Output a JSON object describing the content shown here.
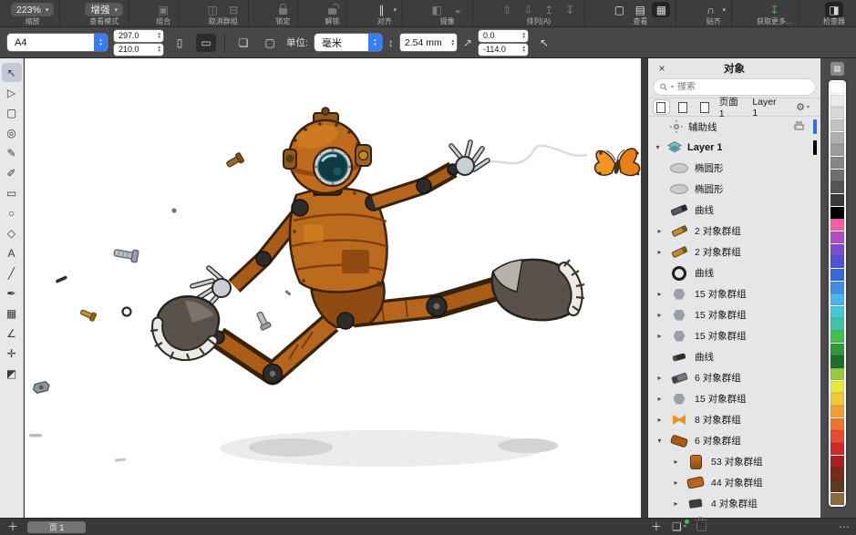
{
  "toolbar": {
    "groups": [
      {
        "type": "dropdown",
        "name": "zoom-level",
        "value": "223%",
        "label": "缩放"
      },
      {
        "type": "dropdown",
        "name": "view-mode",
        "value": "增强",
        "label": "查看模式"
      },
      {
        "type": "icons",
        "name": "combine",
        "label": "组合",
        "disabled": true,
        "icons": [
          {
            "name": "combine",
            "glyph": "▣"
          }
        ]
      },
      {
        "type": "icons",
        "name": "ungroup",
        "label": "取消群组",
        "disabled": true,
        "icons": [
          {
            "name": "ungroup",
            "glyph": "◫"
          },
          {
            "name": "ungroup-all",
            "glyph": "⊟"
          }
        ]
      },
      {
        "type": "icons",
        "name": "lock",
        "label": "锁定",
        "disabled": true,
        "icons": [
          {
            "name": "lock",
            "kind": "lock"
          }
        ]
      },
      {
        "type": "icons",
        "name": "unlock",
        "label": "解锁",
        "disabled": true,
        "icons": [
          {
            "name": "unlock",
            "kind": "lock-open"
          }
        ]
      },
      {
        "type": "icons",
        "name": "align",
        "label": "对齐",
        "dropdown": true,
        "icons": [
          {
            "name": "align",
            "glyph": "∥"
          }
        ]
      },
      {
        "type": "icons",
        "name": "mirror",
        "label": "镜像",
        "disabled": true,
        "icons": [
          {
            "name": "mirror-horizontal",
            "glyph": "◧"
          },
          {
            "name": "mirror-vertical",
            "glyph": "◒"
          }
        ]
      },
      {
        "type": "icons",
        "name": "order",
        "label": "排列(A)",
        "disabled": true,
        "icons": [
          {
            "name": "to-front",
            "glyph": "⇧"
          },
          {
            "name": "to-back",
            "glyph": "⇩"
          },
          {
            "name": "forward-one",
            "glyph": "↥"
          },
          {
            "name": "back-one",
            "glyph": "↧"
          }
        ]
      },
      {
        "type": "icons",
        "name": "view",
        "label": "查看",
        "icons": [
          {
            "name": "page-view",
            "glyph": "▢"
          },
          {
            "name": "wireframe-view",
            "glyph": "▤"
          },
          {
            "name": "pixels-view",
            "glyph": "▦",
            "active": true
          }
        ]
      },
      {
        "type": "icons",
        "name": "snap",
        "label": "贴齐",
        "dropdown": true,
        "icons": [
          {
            "name": "snap-magnet",
            "glyph": "∩"
          }
        ]
      },
      {
        "type": "icons",
        "name": "get-more",
        "label": "获取更多...",
        "icons": [
          {
            "name": "download",
            "glyph": "↧",
            "color": "green"
          }
        ]
      },
      {
        "type": "icons",
        "name": "inspector",
        "label": "检查器",
        "icons": [
          {
            "name": "inspector",
            "glyph": "◨",
            "active": true
          }
        ]
      }
    ]
  },
  "property_bar": {
    "page_size_value": "A4",
    "page_width": "297.0",
    "page_height": "210.0",
    "units_label": "单位:",
    "units_value": "毫米",
    "nudge_value": "2.54 mm",
    "duplicate_x": "0.0",
    "duplicate_y": "-114.0"
  },
  "toolbox": {
    "tools": [
      {
        "name": "pick-tool",
        "glyph": "↖",
        "active": true
      },
      {
        "name": "shape-tool",
        "glyph": "▷"
      },
      {
        "name": "crop-tool",
        "glyph": "▢"
      },
      {
        "name": "zoom-tool",
        "glyph": "◎"
      },
      {
        "name": "freehand-tool",
        "glyph": "✎"
      },
      {
        "name": "artistic-media-tool",
        "glyph": "✐"
      },
      {
        "name": "rectangle-tool",
        "glyph": "▭"
      },
      {
        "name": "ellipse-tool",
        "glyph": "○"
      },
      {
        "name": "polygon-tool",
        "glyph": "◇"
      },
      {
        "name": "text-tool",
        "glyph": "A"
      },
      {
        "name": "line-tool",
        "glyph": "╱"
      },
      {
        "name": "pen-tool",
        "glyph": "✒"
      },
      {
        "name": "table-tool",
        "glyph": "▦"
      },
      {
        "name": "dimension-tool",
        "glyph": "∠"
      },
      {
        "name": "eyedropper-tool",
        "glyph": "✛"
      },
      {
        "name": "fill-tool",
        "glyph": "◩"
      }
    ]
  },
  "objects_panel": {
    "title": "对象",
    "search_placeholder": "搜索",
    "page_label": "页面 1",
    "active_layer_label": "Layer 1",
    "guides_label": "辅助线",
    "guides_color": "#2f6fe4",
    "layer_label": "Layer 1",
    "layer_color": "#000000",
    "rows": [
      {
        "indent": 0,
        "caret": "",
        "kind": "ellipse",
        "label": "椭圆形"
      },
      {
        "indent": 0,
        "caret": "",
        "kind": "ellipse",
        "label": "椭圆形"
      },
      {
        "indent": 0,
        "caret": "",
        "kind": "screw-dark",
        "label": "曲线"
      },
      {
        "indent": 0,
        "caret": "right",
        "kind": "screw-gold",
        "label": "2 对象群组"
      },
      {
        "indent": 0,
        "caret": "right",
        "kind": "screw-gold",
        "label": "2 对象群组"
      },
      {
        "indent": 0,
        "caret": "",
        "kind": "ring",
        "label": "曲线"
      },
      {
        "indent": 0,
        "caret": "right",
        "kind": "nut",
        "label": "15 对象群组"
      },
      {
        "indent": 0,
        "caret": "right",
        "kind": "nut",
        "label": "15 对象群组"
      },
      {
        "indent": 0,
        "caret": "right",
        "kind": "nut",
        "label": "15 对象群组"
      },
      {
        "indent": 0,
        "caret": "",
        "kind": "bolt-dark",
        "label": "曲线"
      },
      {
        "indent": 0,
        "caret": "right",
        "kind": "bolt",
        "label": "6 对象群组"
      },
      {
        "indent": 0,
        "caret": "right",
        "kind": "nut",
        "label": "15 对象群组"
      },
      {
        "indent": 0,
        "caret": "right",
        "kind": "butterfly",
        "label": "8 对象群组"
      },
      {
        "indent": 0,
        "caret": "down",
        "kind": "leg",
        "label": "6 对象群组"
      },
      {
        "indent": 1,
        "caret": "right",
        "kind": "robot",
        "label": "53 对象群组"
      },
      {
        "indent": 1,
        "caret": "right",
        "kind": "leg2",
        "label": "44 对象群组"
      },
      {
        "indent": 1,
        "caret": "right",
        "kind": "dark",
        "label": "4 对象群组"
      }
    ]
  },
  "palette": {
    "colors": [
      "#ffffff",
      "#ebebeb",
      "#d7d7d7",
      "#c3c3c3",
      "#afafaf",
      "#9b9b9b",
      "#868686",
      "#6e6e6e",
      "#555555",
      "#3a3a3a",
      "#000000",
      "#ee5fa4",
      "#b44bc4",
      "#7d4bd0",
      "#4f52d8",
      "#3668e0",
      "#3f8fe8",
      "#49b6ee",
      "#40c8d8",
      "#3cc4a4",
      "#44c04c",
      "#2e9a3c",
      "#1e6e2e",
      "#9ac83c",
      "#e8e83c",
      "#f0c838",
      "#f0a030",
      "#ee7428",
      "#e84c30",
      "#d42828",
      "#a82020",
      "#7c2a18",
      "#5c3a1c",
      "#8a6a3c"
    ]
  },
  "statusbar": {
    "page_tab": "页 1"
  }
}
